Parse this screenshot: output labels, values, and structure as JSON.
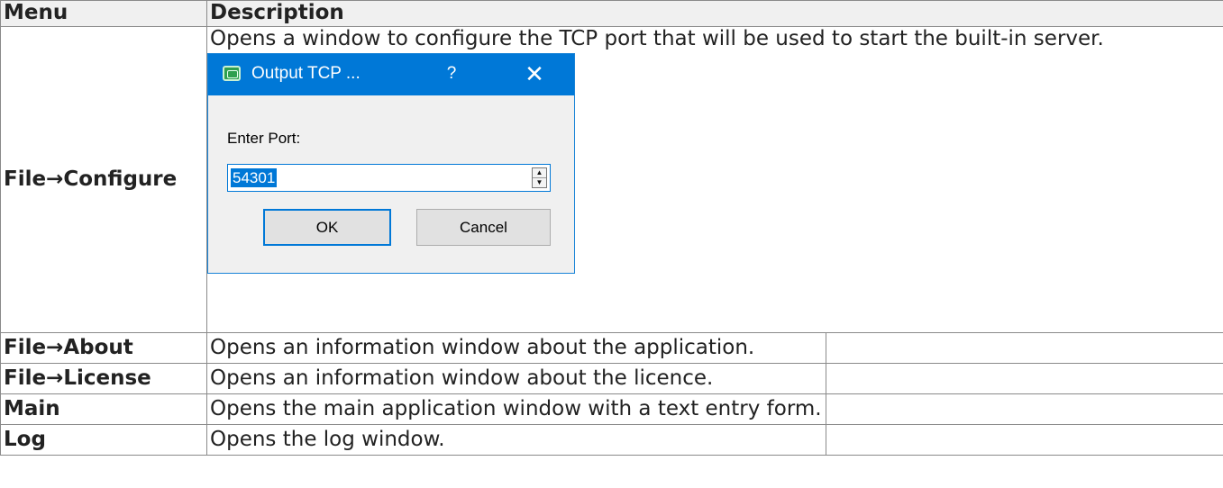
{
  "table": {
    "headers": [
      "Menu",
      "Description",
      ""
    ],
    "rows": [
      {
        "menu": "File→Configure",
        "description": "Opens a window to configure the TCP port that will be used to start the built-in server."
      },
      {
        "menu": "File→About",
        "description": "Opens an information window about the application."
      },
      {
        "menu": "File→License",
        "description": "Opens an information window about the licence."
      },
      {
        "menu": "Main",
        "description": "Opens the main application window with a text entry form."
      },
      {
        "menu": "Log",
        "description": "Opens the log window."
      }
    ]
  },
  "dialog": {
    "title": "Output TCP ...",
    "help_label": "?",
    "close_label": "✕",
    "port_label": "Enter Port:",
    "port_value": "54301",
    "spin_up": "▲",
    "spin_down": "▼",
    "ok_label": "OK",
    "cancel_label": "Cancel",
    "title_color": "#0078d7",
    "accent_color": "#0078d7"
  }
}
